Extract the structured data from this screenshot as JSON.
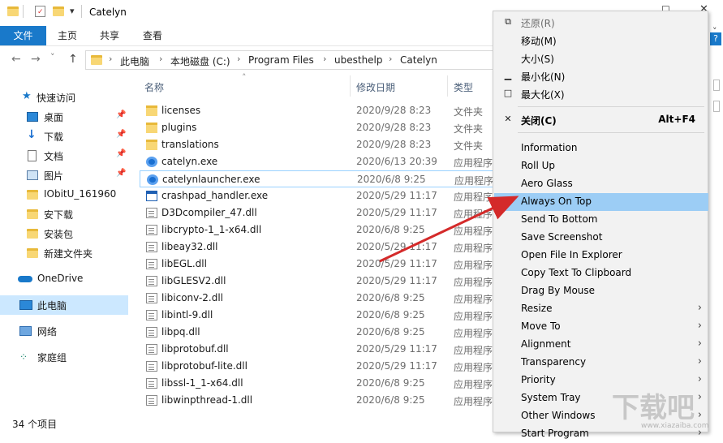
{
  "window": {
    "title": "Catelyn",
    "qa_dropdown": "▾",
    "minimize": "—",
    "maximize": "☐",
    "expand_ribbon": "˅",
    "help": "?"
  },
  "ribbon": {
    "tabs": [
      "文件",
      "主页",
      "共享",
      "查看"
    ]
  },
  "address": {
    "nav": {
      "back": "←",
      "forward": "→",
      "recent": "˅",
      "up": "↑"
    },
    "crumbs": [
      "此电脑",
      "本地磁盘 (C:)",
      "Program Files",
      "ubesthelp",
      "Catelyn"
    ],
    "sep": "›"
  },
  "sidebar": {
    "quick_access": "快速访问",
    "items": [
      {
        "label": "桌面",
        "icon": "desktop-icon",
        "pinned": true
      },
      {
        "label": "下载",
        "icon": "download-icon",
        "pinned": true
      },
      {
        "label": "文档",
        "icon": "document-icon",
        "pinned": true
      },
      {
        "label": "图片",
        "icon": "picture-icon",
        "pinned": true
      },
      {
        "label": "IObitU_161960",
        "icon": "folder-icon",
        "pinned": false
      },
      {
        "label": "安下载",
        "icon": "folder-icon",
        "pinned": false
      },
      {
        "label": "安装包",
        "icon": "folder-icon",
        "pinned": false
      },
      {
        "label": "新建文件夹",
        "icon": "folder-icon",
        "pinned": false
      }
    ],
    "onedrive": "OneDrive",
    "this_pc": "此电脑",
    "network": "网络",
    "homegroup": "家庭组"
  },
  "columns": {
    "name": "名称",
    "date": "修改日期",
    "type": "类型"
  },
  "files": [
    {
      "name": "licenses",
      "date": "2020/9/28 8:23",
      "type": "文件夹",
      "kind": "folder"
    },
    {
      "name": "plugins",
      "date": "2020/9/28 8:23",
      "type": "文件夹",
      "kind": "folder"
    },
    {
      "name": "translations",
      "date": "2020/9/28 8:23",
      "type": "文件夹",
      "kind": "folder"
    },
    {
      "name": "catelyn.exe",
      "date": "2020/6/13 20:39",
      "type": "应用程序",
      "kind": "exe"
    },
    {
      "name": "catelynlauncher.exe",
      "date": "2020/6/8 9:25",
      "type": "应用程序",
      "kind": "exe"
    },
    {
      "name": "crashpad_handler.exe",
      "date": "2020/5/29 11:17",
      "type": "应用程序",
      "kind": "app"
    },
    {
      "name": "D3Dcompiler_47.dll",
      "date": "2020/5/29 11:17",
      "type": "应用程序",
      "kind": "dll"
    },
    {
      "name": "libcrypto-1_1-x64.dll",
      "date": "2020/6/8 9:25",
      "type": "应用程序",
      "kind": "dll"
    },
    {
      "name": "libeay32.dll",
      "date": "2020/5/29 11:17",
      "type": "应用程序",
      "kind": "dll"
    },
    {
      "name": "libEGL.dll",
      "date": "2020/5/29 11:17",
      "type": "应用程序",
      "kind": "dll"
    },
    {
      "name": "libGLESV2.dll",
      "date": "2020/5/29 11:17",
      "type": "应用程序",
      "kind": "dll"
    },
    {
      "name": "libiconv-2.dll",
      "date": "2020/6/8 9:25",
      "type": "应用程序",
      "kind": "dll"
    },
    {
      "name": "libintl-9.dll",
      "date": "2020/6/8 9:25",
      "type": "应用程序",
      "kind": "dll"
    },
    {
      "name": "libpq.dll",
      "date": "2020/6/8 9:25",
      "type": "应用程序",
      "kind": "dll"
    },
    {
      "name": "libprotobuf.dll",
      "date": "2020/5/29 11:17",
      "type": "应用程序",
      "kind": "dll"
    },
    {
      "name": "libprotobuf-lite.dll",
      "date": "2020/5/29 11:17",
      "type": "应用程序",
      "kind": "dll"
    },
    {
      "name": "libssl-1_1-x64.dll",
      "date": "2020/6/8 9:25",
      "type": "应用程序",
      "kind": "dll"
    },
    {
      "name": "libwinpthread-1.dll",
      "date": "2020/6/8 9:25",
      "type": "应用程序",
      "kind": "dll"
    }
  ],
  "status": {
    "count": "34 个项目"
  },
  "context_menu": {
    "system_items": [
      {
        "label": "还原(R)",
        "glyph": "⧉",
        "disabled": true
      },
      {
        "label": "移动(M)",
        "glyph": "",
        "disabled": false
      },
      {
        "label": "大小(S)",
        "glyph": "",
        "disabled": false
      },
      {
        "label": "最小化(N)",
        "glyph": "▁",
        "disabled": false
      },
      {
        "label": "最大化(X)",
        "glyph": "□",
        "disabled": false
      }
    ],
    "close": {
      "label": "关闭(C)",
      "glyph": "✕",
      "shortcut": "Alt+F4"
    },
    "items": [
      {
        "label": "Information",
        "submenu": false
      },
      {
        "label": "Roll Up",
        "submenu": false
      },
      {
        "label": "Aero Glass",
        "submenu": false
      },
      {
        "label": "Always On Top",
        "submenu": false,
        "highlighted": true
      },
      {
        "label": "Send To Bottom",
        "submenu": false
      },
      {
        "label": "Save Screenshot",
        "submenu": false
      },
      {
        "label": "Open File In Explorer",
        "submenu": false
      },
      {
        "label": "Copy Text To Clipboard",
        "submenu": false
      },
      {
        "label": "Drag By Mouse",
        "submenu": false
      },
      {
        "label": "Resize",
        "submenu": true
      },
      {
        "label": "Move To",
        "submenu": true
      },
      {
        "label": "Alignment",
        "submenu": true
      },
      {
        "label": "Transparency",
        "submenu": true
      },
      {
        "label": "Priority",
        "submenu": true
      },
      {
        "label": "System Tray",
        "submenu": true
      },
      {
        "label": "Other Windows",
        "submenu": true
      },
      {
        "label": "Start Program",
        "submenu": true
      }
    ],
    "submenu_arrow": "›"
  },
  "watermark": {
    "text": "下载吧",
    "sub": "www.xiazaiba.com"
  },
  "colors": {
    "accent": "#1979ca",
    "menu_highlight": "#9ccdf5",
    "arrow": "#d42a2a",
    "selection": "#cce8ff"
  }
}
